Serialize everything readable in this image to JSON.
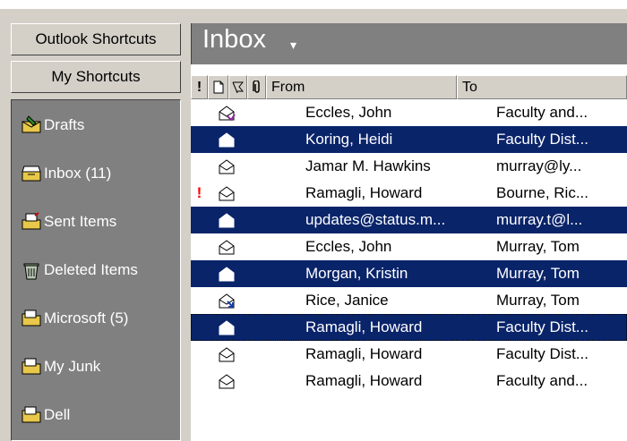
{
  "shortcuts": {
    "outlook_label": "Outlook Shortcuts",
    "my_label": "My Shortcuts",
    "items": [
      {
        "label": "Drafts",
        "icon": "drafts-icon"
      },
      {
        "label": "Inbox (11)",
        "icon": "inbox-icon"
      },
      {
        "label": "Sent Items",
        "icon": "sent-items-icon"
      },
      {
        "label": "Deleted Items",
        "icon": "deleted-items-icon"
      },
      {
        "label": "Microsoft (5)",
        "icon": "folder-icon"
      },
      {
        "label": "My Junk",
        "icon": "folder-icon"
      },
      {
        "label": "Dell",
        "icon": "folder-icon"
      }
    ]
  },
  "inbox": {
    "title": "Inbox",
    "caret": "▾"
  },
  "columns": {
    "importance": "!",
    "from": "From",
    "to": "To"
  },
  "messages": [
    {
      "from": "Eccles, John",
      "to": "Faculty and...",
      "selected": false,
      "important": false,
      "icon": "replied-envelope-icon"
    },
    {
      "from": "Koring, Heidi",
      "to": "Faculty Dist...",
      "selected": true,
      "important": false,
      "icon": "open-envelope-icon"
    },
    {
      "from": "Jamar M. Hawkins",
      "to": "murray@ly...",
      "selected": false,
      "important": false,
      "icon": "open-envelope-icon"
    },
    {
      "from": "Ramagli, Howard",
      "to": "Bourne, Ric...",
      "selected": false,
      "important": true,
      "icon": "open-envelope-icon"
    },
    {
      "from": "updates@status.m...",
      "to": "murray.t@l...",
      "selected": true,
      "important": false,
      "icon": "open-envelope-icon"
    },
    {
      "from": "Eccles, John",
      "to": "Murray, Tom",
      "selected": false,
      "important": false,
      "icon": "open-envelope-icon"
    },
    {
      "from": "Morgan, Kristin",
      "to": "Murray, Tom",
      "selected": true,
      "important": false,
      "icon": "open-envelope-icon"
    },
    {
      "from": "Rice, Janice",
      "to": "Murray, Tom",
      "selected": false,
      "important": false,
      "icon": "forwarded-envelope-icon"
    },
    {
      "from": "Ramagli, Howard",
      "to": "Faculty Dist...",
      "selected": true,
      "important": false,
      "icon": "open-envelope-icon"
    },
    {
      "from": "Ramagli, Howard",
      "to": "Faculty Dist...",
      "selected": false,
      "important": false,
      "icon": "open-envelope-icon"
    },
    {
      "from": "Ramagli, Howard",
      "to": "Faculty and...",
      "selected": false,
      "important": false,
      "icon": "open-envelope-icon"
    }
  ],
  "colors": {
    "selection": "#0a246a",
    "panel_gray": "#808080",
    "importance_red": "#ff0000"
  }
}
